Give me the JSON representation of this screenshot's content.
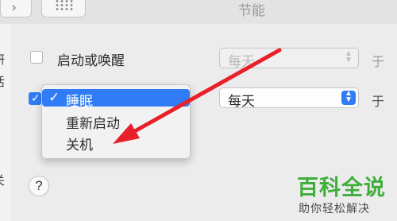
{
  "window": {
    "title": "节能"
  },
  "toolbar": {
    "forward_icon": "chevron-right-icon",
    "grid_icon": "grid-icon"
  },
  "sidebar_edge": {
    "fragments": [
      "研",
      "活",
      "关"
    ]
  },
  "schedule": {
    "row1": {
      "label": "启动或唤醒",
      "checked": false,
      "frequency": "每天",
      "suffix": "于"
    },
    "row2": {
      "checked": true,
      "frequency": "每天",
      "suffix": "于"
    }
  },
  "popup_menu": {
    "items": [
      {
        "label": "睡眠",
        "selected": true
      },
      {
        "label": "重新启动",
        "selected": false
      },
      {
        "label": "关机",
        "selected": false
      }
    ]
  },
  "help": {
    "label": "?"
  },
  "watermark": {
    "title": "百科全说",
    "subtitle": "助你轻松解决"
  },
  "colors": {
    "accent": "#2f7cf6",
    "arrow": "#e8202a",
    "watermark": "#3fae3b"
  }
}
